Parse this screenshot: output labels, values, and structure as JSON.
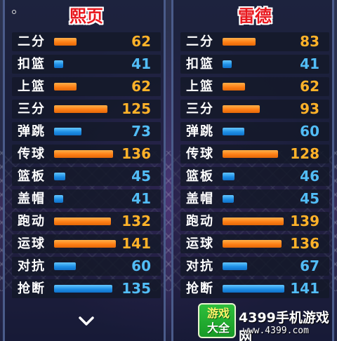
{
  "colors": {
    "orange_bar": "#ff7f16",
    "blue_bar": "#1e8fe6",
    "name_red": "#e8161c"
  },
  "left_player": {
    "name": "熙页",
    "stats": [
      {
        "label": "二分",
        "value": "62",
        "color": "orange",
        "level": 0.24
      },
      {
        "label": "扣篮",
        "value": "41",
        "color": "blue",
        "level": 0.1
      },
      {
        "label": "上篮",
        "value": "62",
        "color": "orange",
        "level": 0.24
      },
      {
        "label": "三分",
        "value": "125",
        "color": "orange",
        "level": 0.57
      },
      {
        "label": "弹跳",
        "value": "73",
        "color": "blue",
        "level": 0.29
      },
      {
        "label": "传球",
        "value": "136",
        "color": "orange",
        "level": 0.63
      },
      {
        "label": "篮板",
        "value": "45",
        "color": "blue",
        "level": 0.12
      },
      {
        "label": "盖帽",
        "value": "41",
        "color": "blue",
        "level": 0.1
      },
      {
        "label": "跑动",
        "value": "132",
        "color": "orange",
        "level": 0.61
      },
      {
        "label": "运球",
        "value": "141",
        "color": "orange",
        "level": 0.66
      },
      {
        "label": "对抗",
        "value": "60",
        "color": "blue",
        "level": 0.23
      },
      {
        "label": "抢断",
        "value": "135",
        "color": "blue",
        "level": 0.62
      }
    ]
  },
  "right_player": {
    "name": "雷德",
    "stats": [
      {
        "label": "二分",
        "value": "83",
        "color": "orange",
        "level": 0.35
      },
      {
        "label": "扣篮",
        "value": "41",
        "color": "blue",
        "level": 0.1
      },
      {
        "label": "上篮",
        "value": "62",
        "color": "orange",
        "level": 0.24
      },
      {
        "label": "三分",
        "value": "93",
        "color": "orange",
        "level": 0.4
      },
      {
        "label": "弹跳",
        "value": "60",
        "color": "blue",
        "level": 0.23
      },
      {
        "label": "传球",
        "value": "128",
        "color": "orange",
        "level": 0.59
      },
      {
        "label": "篮板",
        "value": "46",
        "color": "blue",
        "level": 0.13
      },
      {
        "label": "盖帽",
        "value": "45",
        "color": "blue",
        "level": 0.12
      },
      {
        "label": "跑动",
        "value": "139",
        "color": "orange",
        "level": 0.65
      },
      {
        "label": "运球",
        "value": "136",
        "color": "orange",
        "level": 0.63
      },
      {
        "label": "对抗",
        "value": "67",
        "color": "blue",
        "level": 0.26
      },
      {
        "label": "抢断",
        "value": "141",
        "color": "blue",
        "level": 0.66
      }
    ]
  },
  "watermark": {
    "logo_line1": "游戏",
    "logo_line2": "大全",
    "title": "4399手机游戏网",
    "url": "www.4399.com"
  },
  "icons": {
    "expand": "chevron-down-icon"
  }
}
